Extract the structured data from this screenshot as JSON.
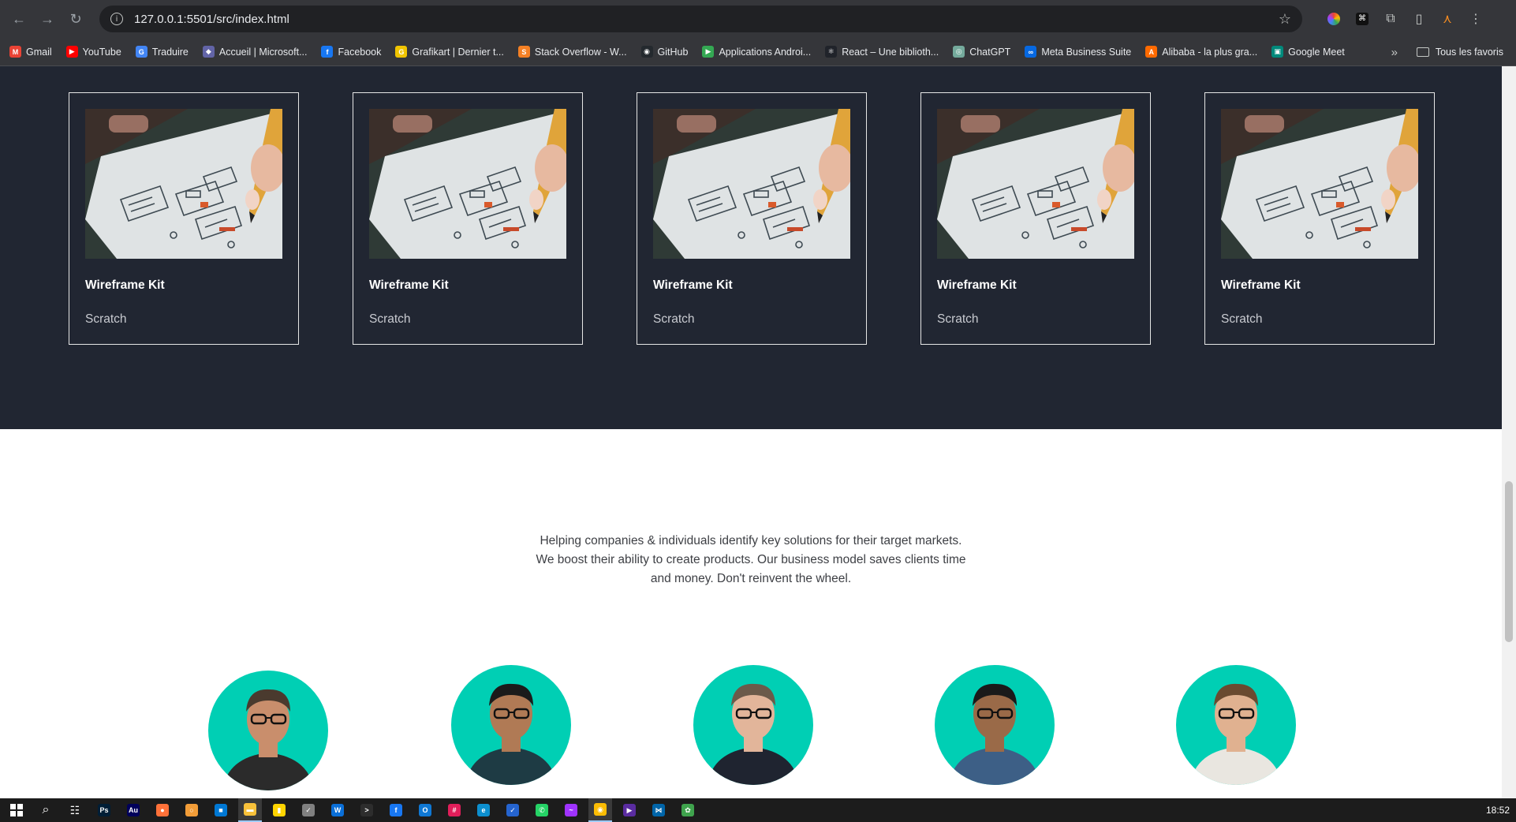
{
  "browser": {
    "url": "127.0.0.1:5501/src/index.html",
    "bookmarks": [
      {
        "label": "Gmail",
        "color": "#ea4335",
        "glyph": "M"
      },
      {
        "label": "YouTube",
        "color": "#ff0000",
        "glyph": "▶"
      },
      {
        "label": "Traduire",
        "color": "#4285f4",
        "glyph": "G"
      },
      {
        "label": "Accueil | Microsoft...",
        "color": "#6264a7",
        "glyph": "◆"
      },
      {
        "label": "Facebook",
        "color": "#1877f2",
        "glyph": "f"
      },
      {
        "label": "Grafikart | Dernier t...",
        "color": "#f0c400",
        "glyph": "G"
      },
      {
        "label": "Stack Overflow - W...",
        "color": "#f48024",
        "glyph": "S"
      },
      {
        "label": "GitHub",
        "color": "#24292e",
        "glyph": "◉"
      },
      {
        "label": "Applications Androi...",
        "color": "#34a853",
        "glyph": "▶"
      },
      {
        "label": "React – Une biblioth...",
        "color": "#20232a",
        "glyph": "⚛"
      },
      {
        "label": "ChatGPT",
        "color": "#74aa9c",
        "glyph": "◎"
      },
      {
        "label": "Meta Business Suite",
        "color": "#0668e1",
        "glyph": "∞"
      },
      {
        "label": "Alibaba - la plus gra...",
        "color": "#ff6a00",
        "glyph": "A"
      },
      {
        "label": "Google Meet",
        "color": "#00897b",
        "glyph": "▣"
      }
    ],
    "all_bookmarks_label": "Tous les favoris"
  },
  "portfolio": {
    "cards": [
      {
        "title": "Wireframe Kit",
        "subtitle": "Scratch"
      },
      {
        "title": "Wireframe Kit",
        "subtitle": "Scratch"
      },
      {
        "title": "Wireframe Kit",
        "subtitle": "Scratch"
      },
      {
        "title": "Wireframe Kit",
        "subtitle": "Scratch"
      },
      {
        "title": "Wireframe Kit",
        "subtitle": "Scratch"
      }
    ]
  },
  "about": {
    "line1": "Helping companies & individuals identify key solutions for their target markets.",
    "line2": "We boost their ability to create products. Our business model saves clients time",
    "line3": "and money. Don't reinvent the wheel."
  },
  "team": {
    "accent": "#00cfb4",
    "members": [
      {
        "shirt": "#2b2b2b",
        "skin": "#c98e6c",
        "hair": "#4a3a2e"
      },
      {
        "shirt": "#1e3b44",
        "skin": "#b07a55",
        "hair": "#1b1b1b"
      },
      {
        "shirt": "#1f2430",
        "skin": "#e2b59a",
        "hair": "#6b5a4a"
      },
      {
        "shirt": "#3d5f86",
        "skin": "#9a6a48",
        "hair": "#1a1a1a"
      },
      {
        "shirt": "#e9e6e0",
        "skin": "#e0b190",
        "hair": "#6a4a30"
      }
    ]
  },
  "taskbar": {
    "time": "18:52",
    "apps": [
      {
        "name": "photoshop",
        "color": "#001e36",
        "glyph": "Ps"
      },
      {
        "name": "audition",
        "color": "#00005b",
        "glyph": "Au"
      },
      {
        "name": "firefox",
        "color": "#ff7139",
        "glyph": "●"
      },
      {
        "name": "search-tool",
        "color": "#f29d38",
        "glyph": "○"
      },
      {
        "name": "store",
        "color": "#0078d4",
        "glyph": "■"
      },
      {
        "name": "file-explorer",
        "color": "#f8c13a",
        "glyph": "▬"
      },
      {
        "name": "sticky-notes",
        "color": "#ffd400",
        "glyph": "▮"
      },
      {
        "name": "app-check",
        "color": "#808080",
        "glyph": "✓"
      },
      {
        "name": "webstorm",
        "color": "#0a6fd8",
        "glyph": "W"
      },
      {
        "name": "terminal",
        "color": "#2d2d2d",
        "glyph": ">"
      },
      {
        "name": "facebook",
        "color": "#1877f2",
        "glyph": "f"
      },
      {
        "name": "outlook",
        "color": "#0f78d4",
        "glyph": "O"
      },
      {
        "name": "slack",
        "color": "#e01e5a",
        "glyph": "#"
      },
      {
        "name": "edge",
        "color": "#0c8fcf",
        "glyph": "e"
      },
      {
        "name": "todo",
        "color": "#2564cf",
        "glyph": "✓"
      },
      {
        "name": "whatsapp",
        "color": "#25d366",
        "glyph": "✆"
      },
      {
        "name": "messenger",
        "color": "#a033ff",
        "glyph": "~"
      },
      {
        "name": "chrome",
        "color": "#fbbc04",
        "glyph": "◉"
      },
      {
        "name": "media-player",
        "color": "#5a2ca0",
        "glyph": "▶"
      },
      {
        "name": "vscode",
        "color": "#0065a9",
        "glyph": "⋈"
      },
      {
        "name": "game-app",
        "color": "#3fa34d",
        "glyph": "✿"
      }
    ]
  }
}
